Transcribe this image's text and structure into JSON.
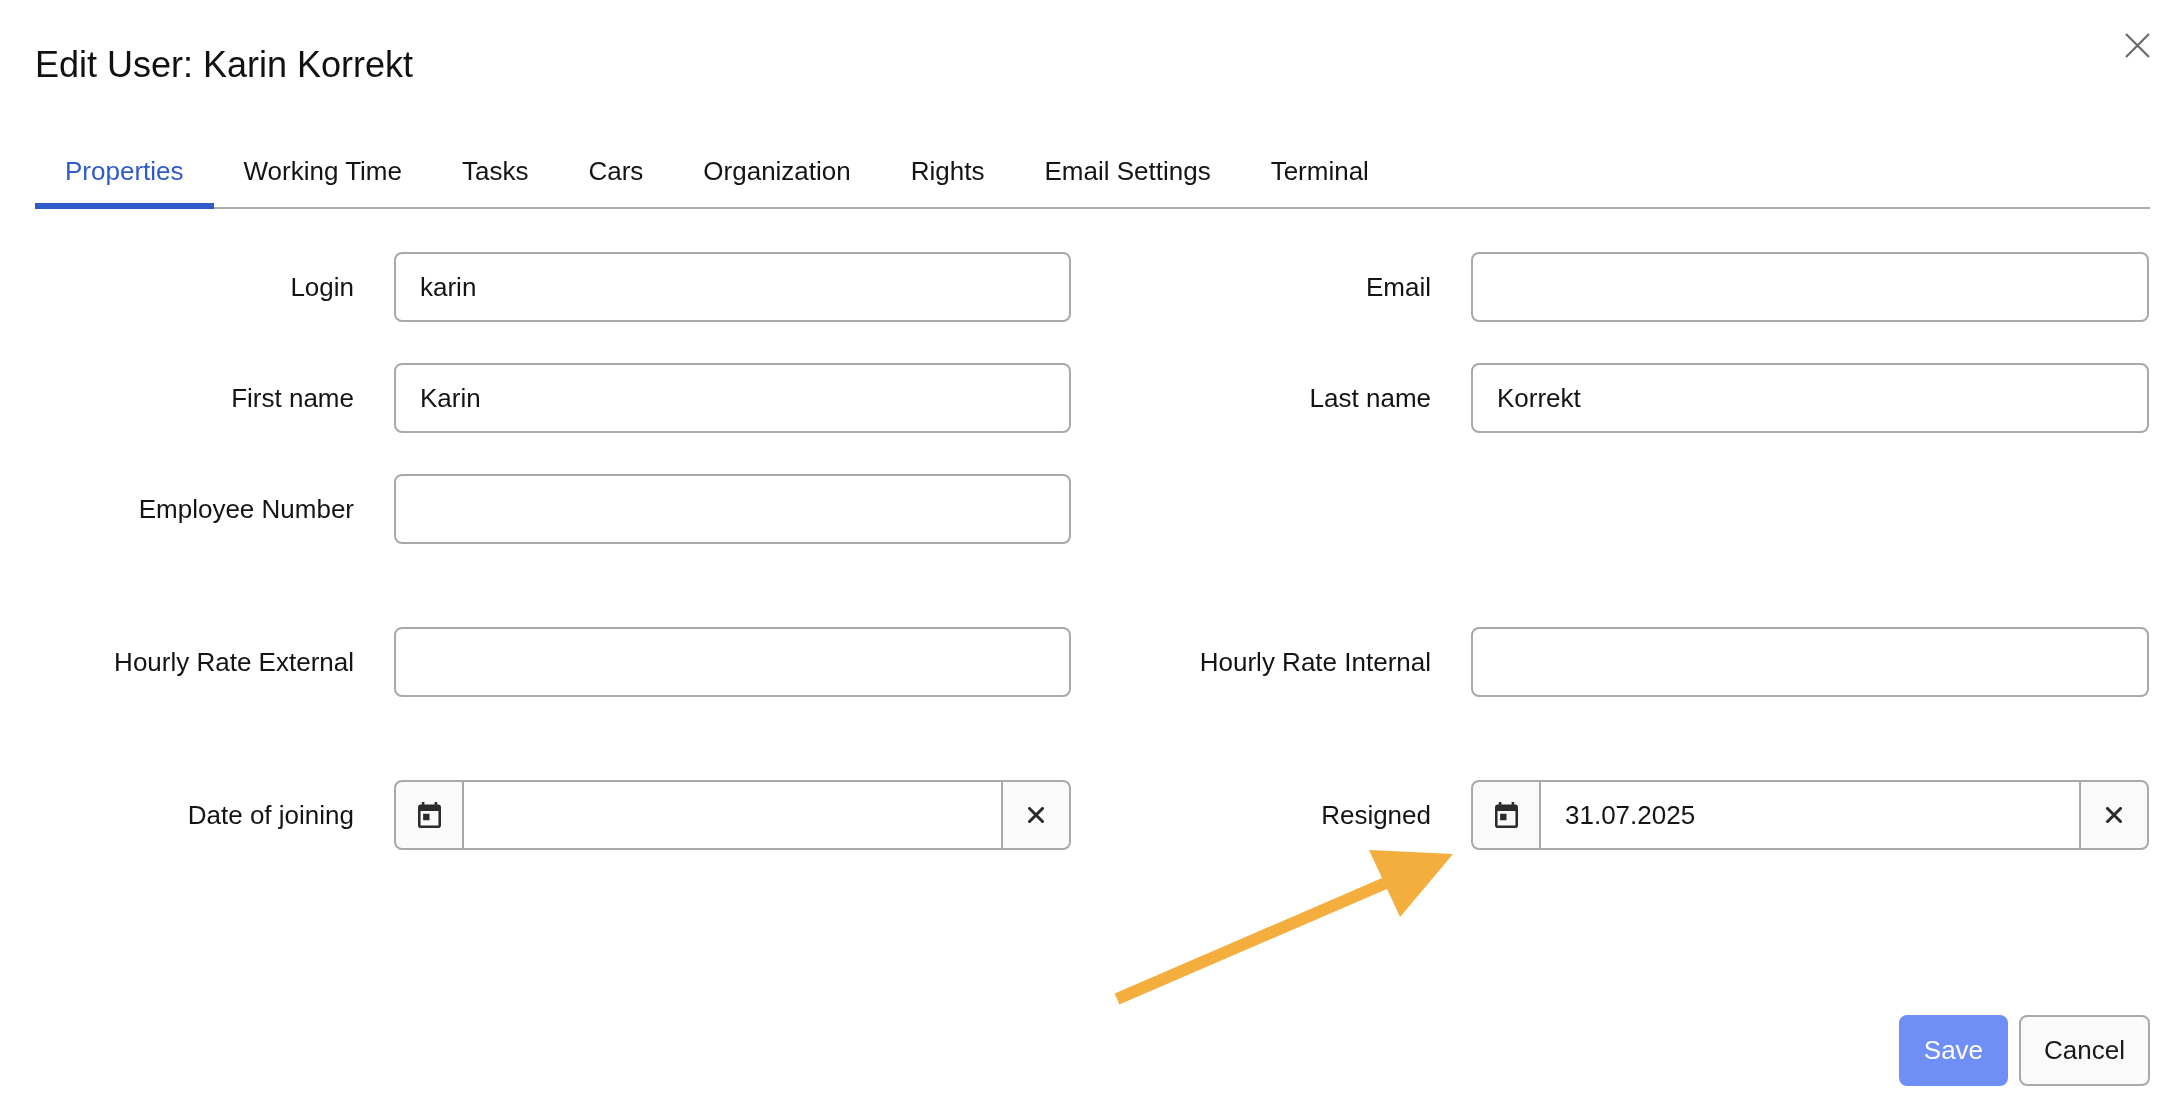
{
  "dialog": {
    "title": "Edit User: Karin Korrekt"
  },
  "tabs": [
    {
      "label": "Properties",
      "selected": true
    },
    {
      "label": "Working Time",
      "selected": false
    },
    {
      "label": "Tasks",
      "selected": false
    },
    {
      "label": "Cars",
      "selected": false
    },
    {
      "label": "Organization",
      "selected": false
    },
    {
      "label": "Rights",
      "selected": false
    },
    {
      "label": "Email Settings",
      "selected": false
    },
    {
      "label": "Terminal",
      "selected": false
    }
  ],
  "form": {
    "sections": [
      {
        "rows": [
          {
            "left": {
              "label": "Login",
              "kind": "text",
              "value": "karin"
            },
            "right": {
              "label": "Email",
              "kind": "text"
            }
          },
          {
            "left": {
              "label": "First name",
              "kind": "text",
              "value": "Karin"
            },
            "right": {
              "label": "Last name",
              "kind": "text",
              "value": "Korrekt"
            }
          },
          {
            "left": {
              "label": "Employee Number",
              "kind": "text"
            }
          }
        ]
      },
      {
        "rows": [
          {
            "left": {
              "label": "Hourly Rate External",
              "kind": "text"
            },
            "right": {
              "label": "Hourly Rate Internal",
              "kind": "text"
            }
          }
        ]
      },
      {
        "rows": [
          {
            "left": {
              "label": "Date of joining",
              "kind": "date"
            },
            "right": {
              "label": "Resigned",
              "kind": "date",
              "value": "31.07.2025"
            }
          }
        ]
      }
    ]
  },
  "buttons": [
    {
      "label": "Save",
      "kind": "primary"
    },
    {
      "label": "Cancel",
      "kind": "secondary"
    }
  ],
  "annotations": [
    {
      "kind": "arrow"
    }
  ]
}
